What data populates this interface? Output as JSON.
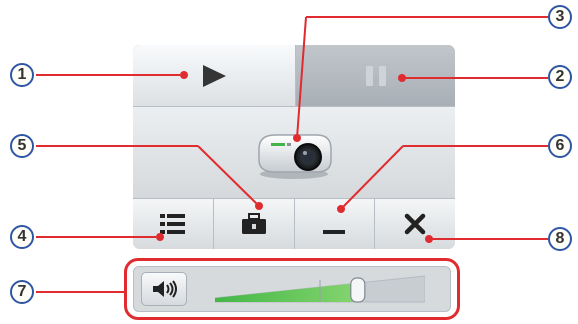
{
  "controls": {
    "play_icon": "play-icon",
    "pause_icon": "pause-icon",
    "projector_icon": "projector-icon",
    "list_icon": "list-icon",
    "toolbox_icon": "toolbox-icon",
    "minimize_icon": "minimize-icon",
    "close_icon": "close-icon",
    "speaker_icon": "speaker-icon"
  },
  "volume": {
    "level": 0.68
  },
  "callouts": {
    "c1": "1",
    "c2": "2",
    "c3": "3",
    "c4": "4",
    "c5": "5",
    "c6": "6",
    "c7": "7",
    "c8": "8"
  },
  "colors": {
    "leader_line": "#e02b2f",
    "callout_border": "#2f56a5"
  }
}
